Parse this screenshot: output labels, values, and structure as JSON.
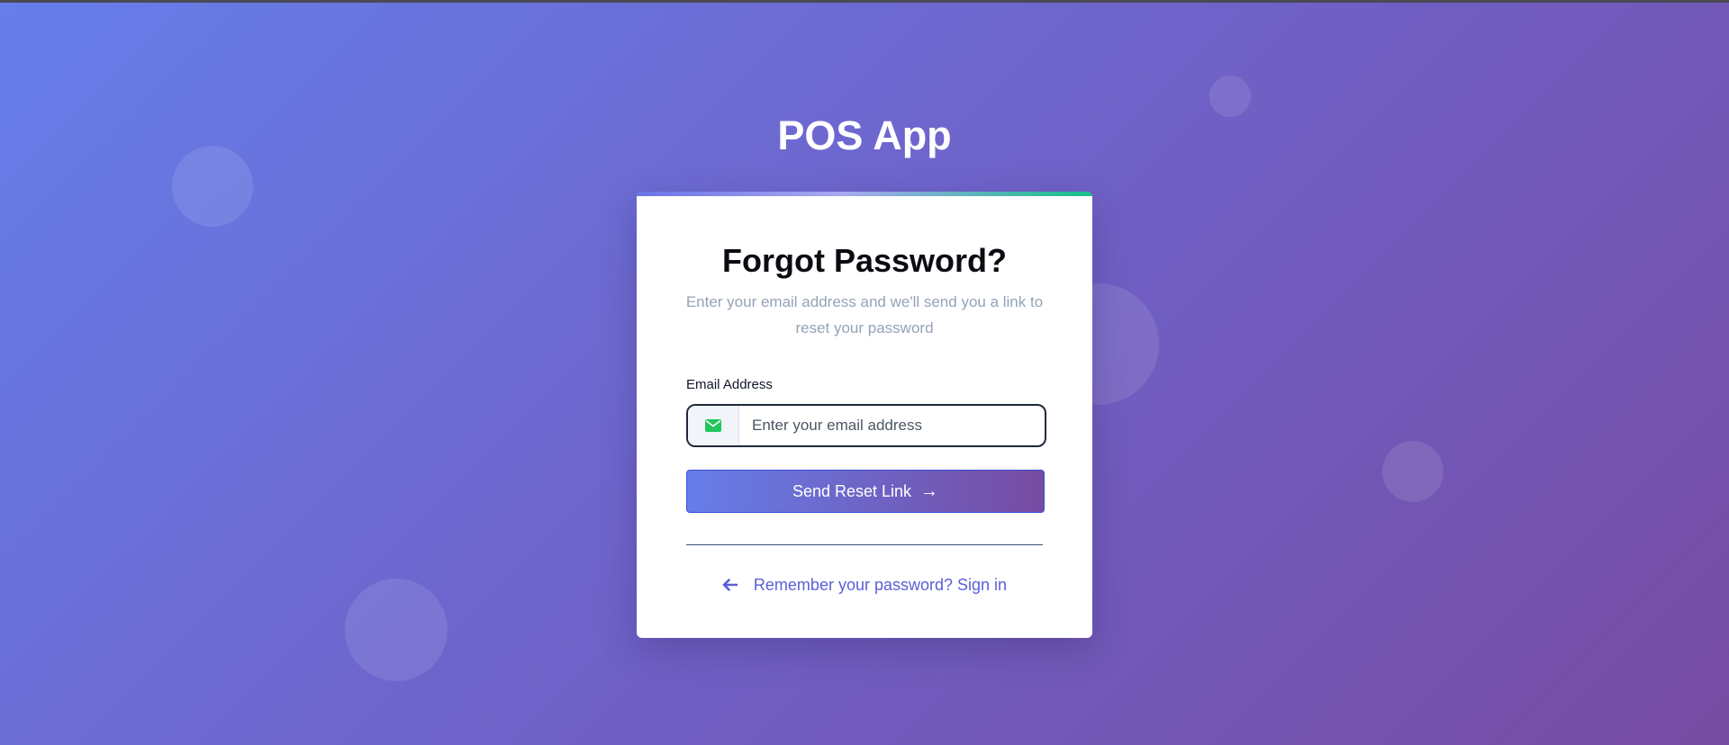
{
  "app": {
    "title": "POS App"
  },
  "card": {
    "heading": "Forgot Password?",
    "subtitle": "Enter your email address and we'll send you a link to reset your password"
  },
  "form": {
    "email_label": "Email Address",
    "email_placeholder": "Enter your email address",
    "email_value": "",
    "email_icon": "envelope-icon",
    "submit_label": "Send Reset Link",
    "submit_arrow": "→"
  },
  "footer": {
    "signin_link": "Remember your password? Sign in",
    "back_icon": "arrow-left-icon"
  },
  "colors": {
    "gradient_start": "#667eea",
    "gradient_end": "#764ba2",
    "link": "#5b5fd8",
    "icon_accent": "#22c55e",
    "accent_bar_end": "#17c08a"
  }
}
